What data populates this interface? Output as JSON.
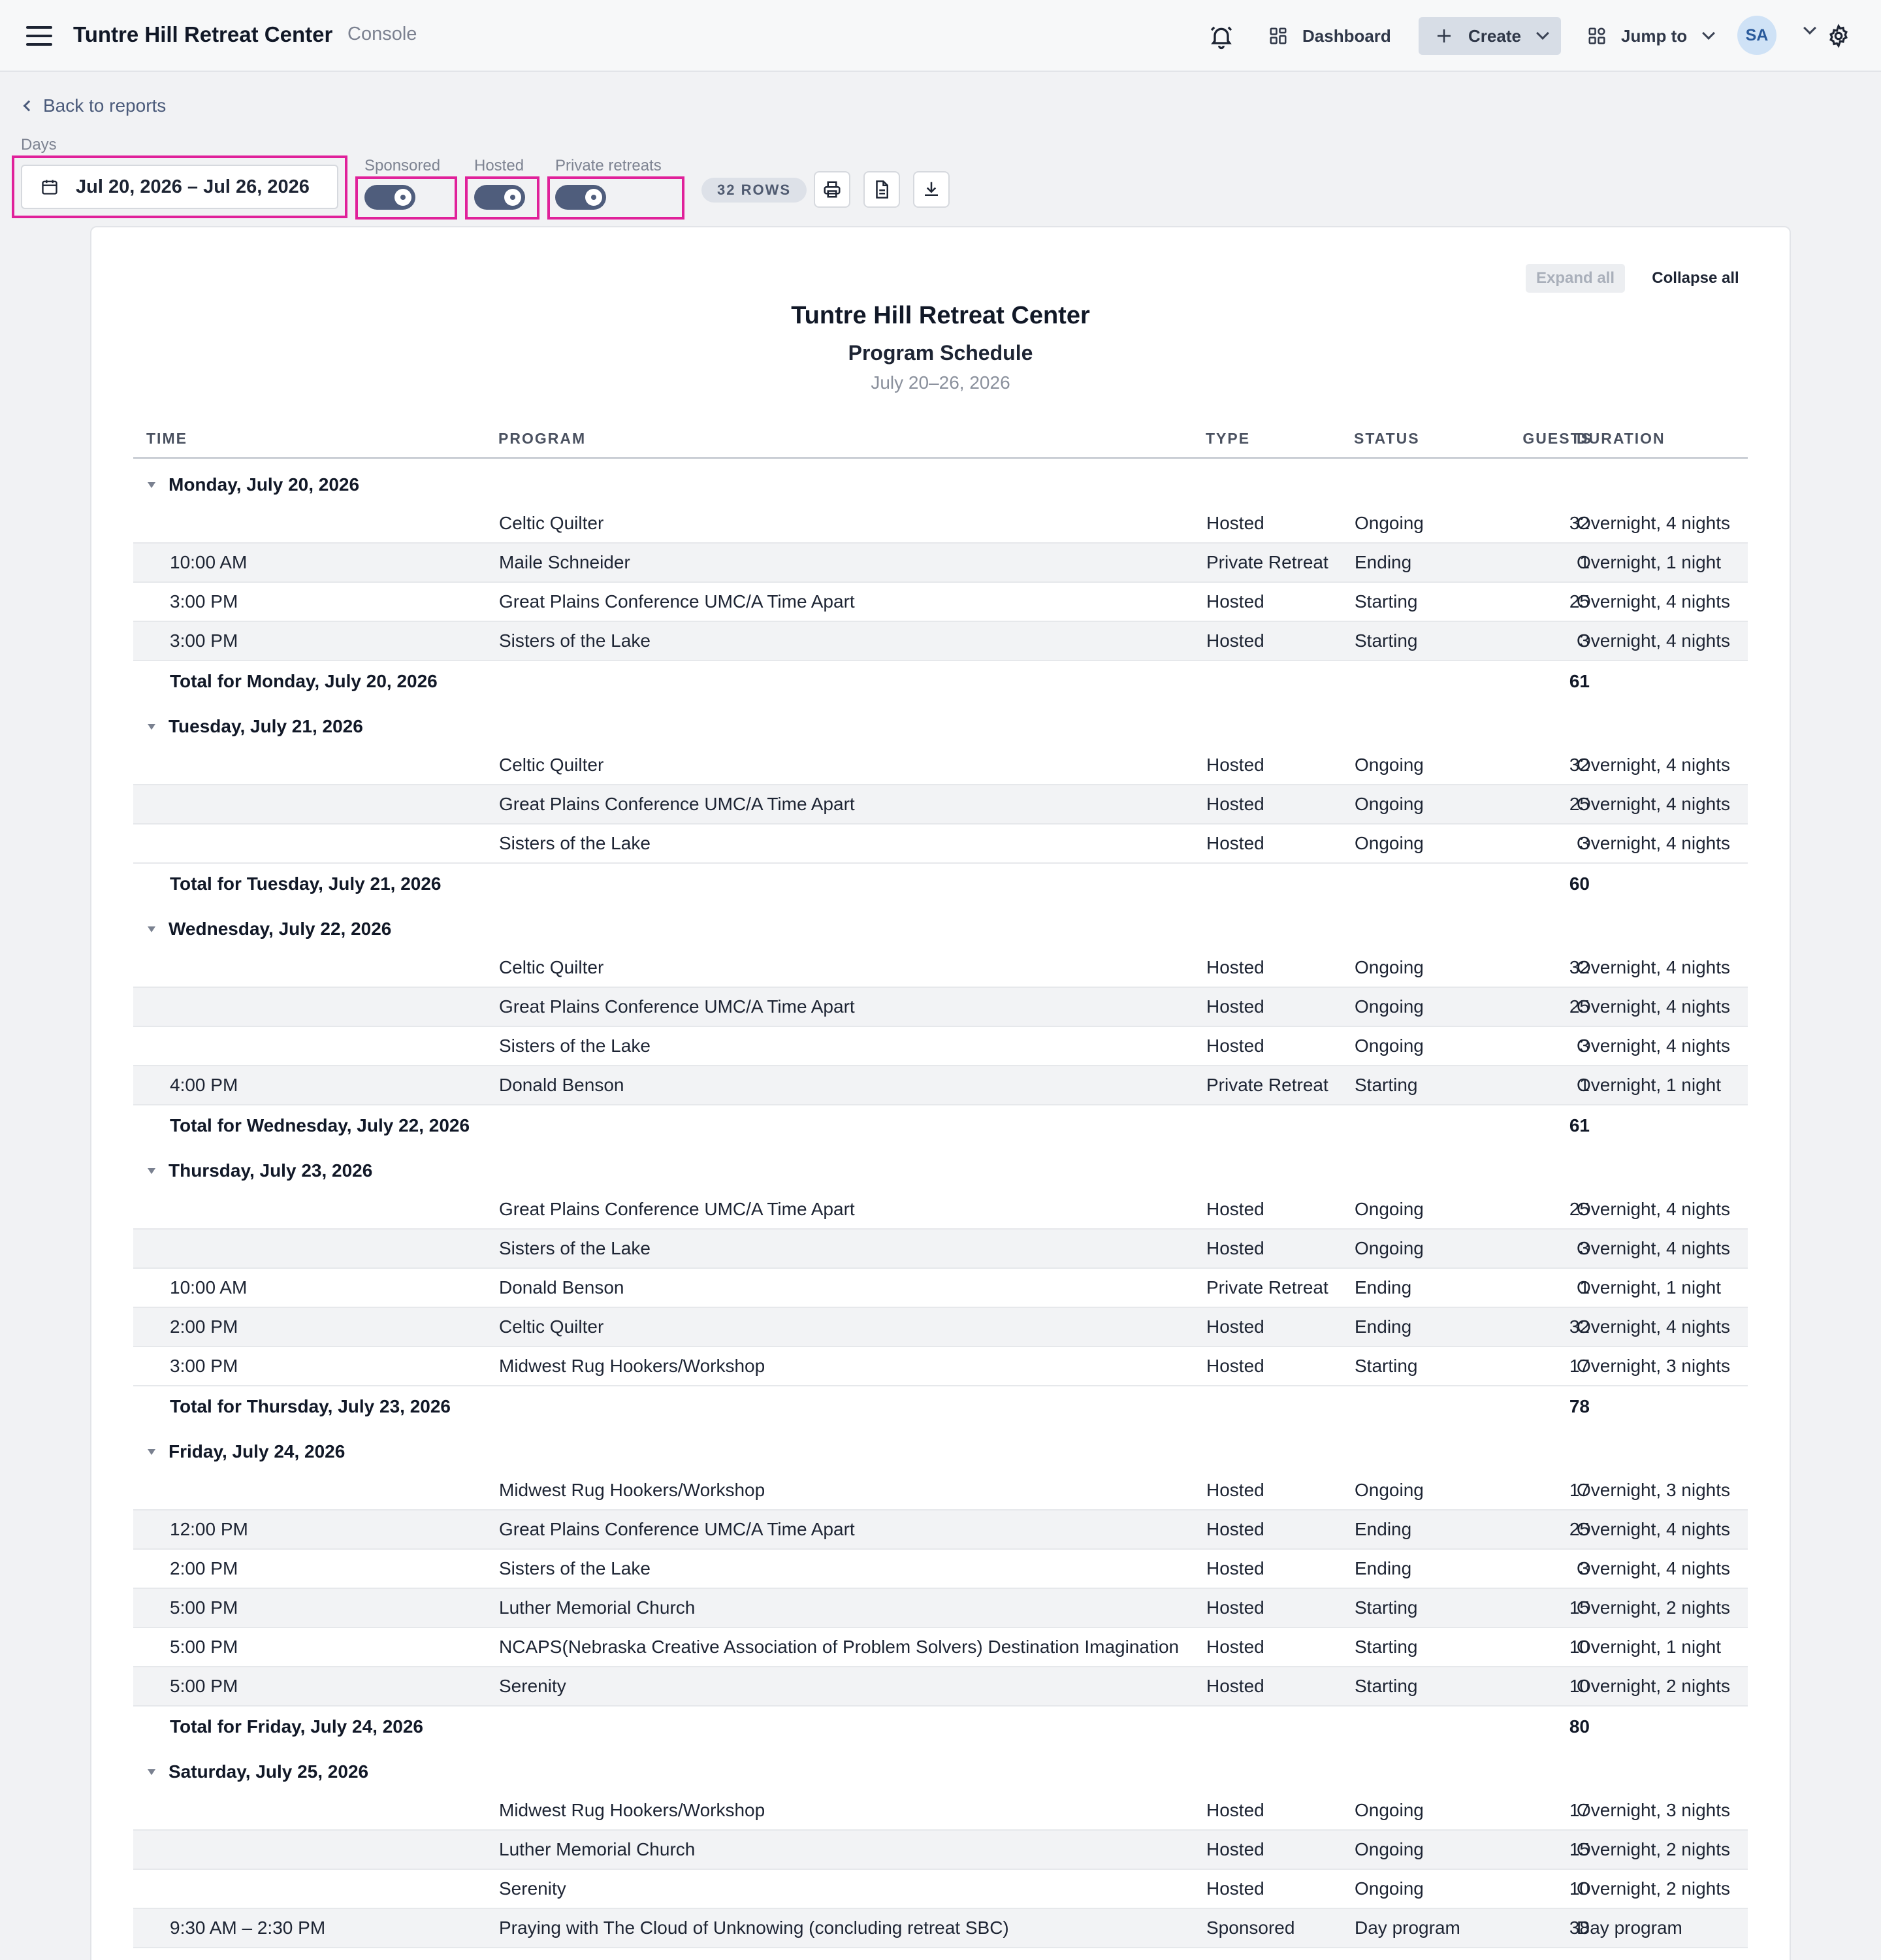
{
  "header": {
    "app_title": "Tuntre Hill Retreat Center",
    "app_subtitle": "Console",
    "dashboard_label": "Dashboard",
    "create_label": "Create",
    "jump_label": "Jump to",
    "avatar_initials": "SA"
  },
  "nav": {
    "back_label": "Back to reports"
  },
  "filters": {
    "days_label": "Days",
    "date_range": "Jul 20, 2026 – Jul 26, 2026",
    "sponsored_label": "Sponsored",
    "hosted_label": "Hosted",
    "private_label": "Private retreats",
    "toggles_on": true,
    "rows_badge": "32 ROWS"
  },
  "report": {
    "expand_label": "Expand all",
    "collapse_label": "Collapse all",
    "title": "Tuntre Hill Retreat Center",
    "subtitle": "Program Schedule",
    "dates": "July 20–26, 2026",
    "columns": {
      "time": "TIME",
      "program": "PROGRAM",
      "type": "TYPE",
      "status": "STATUS",
      "guests": "GUESTS",
      "duration": "DURATION"
    },
    "days": [
      {
        "heading": "Monday, July 20, 2026",
        "rows": [
          {
            "time": "",
            "program": "Celtic Quilter",
            "type": "Hosted",
            "status": "Ongoing",
            "guests": "32",
            "duration": "Overnight, 4 nights"
          },
          {
            "time": "10:00 AM",
            "program": "Maile Schneider",
            "type": "Private Retreat",
            "status": "Ending",
            "guests": "1",
            "duration": "Overnight, 1 night"
          },
          {
            "time": "3:00 PM",
            "program": "Great Plains Conference UMC/A Time Apart",
            "type": "Hosted",
            "status": "Starting",
            "guests": "25",
            "duration": "Overnight, 4 nights"
          },
          {
            "time": "3:00 PM",
            "program": "Sisters of the Lake",
            "type": "Hosted",
            "status": "Starting",
            "guests": "3",
            "duration": "Overnight, 4 nights"
          }
        ],
        "total_label": "Total for Monday, July 20, 2026",
        "total": "61"
      },
      {
        "heading": "Tuesday, July 21, 2026",
        "rows": [
          {
            "time": "",
            "program": "Celtic Quilter",
            "type": "Hosted",
            "status": "Ongoing",
            "guests": "32",
            "duration": "Overnight, 4 nights"
          },
          {
            "time": "",
            "program": "Great Plains Conference UMC/A Time Apart",
            "type": "Hosted",
            "status": "Ongoing",
            "guests": "25",
            "duration": "Overnight, 4 nights"
          },
          {
            "time": "",
            "program": "Sisters of the Lake",
            "type": "Hosted",
            "status": "Ongoing",
            "guests": "3",
            "duration": "Overnight, 4 nights"
          }
        ],
        "total_label": "Total for Tuesday, July 21, 2026",
        "total": "60"
      },
      {
        "heading": "Wednesday, July 22, 2026",
        "rows": [
          {
            "time": "",
            "program": "Celtic Quilter",
            "type": "Hosted",
            "status": "Ongoing",
            "guests": "32",
            "duration": "Overnight, 4 nights"
          },
          {
            "time": "",
            "program": "Great Plains Conference UMC/A Time Apart",
            "type": "Hosted",
            "status": "Ongoing",
            "guests": "25",
            "duration": "Overnight, 4 nights"
          },
          {
            "time": "",
            "program": "Sisters of the Lake",
            "type": "Hosted",
            "status": "Ongoing",
            "guests": "3",
            "duration": "Overnight, 4 nights"
          },
          {
            "time": "4:00 PM",
            "program": "Donald Benson",
            "type": "Private Retreat",
            "status": "Starting",
            "guests": "1",
            "duration": "Overnight, 1 night"
          }
        ],
        "total_label": "Total for Wednesday, July 22, 2026",
        "total": "61"
      },
      {
        "heading": "Thursday, July 23, 2026",
        "rows": [
          {
            "time": "",
            "program": "Great Plains Conference UMC/A Time Apart",
            "type": "Hosted",
            "status": "Ongoing",
            "guests": "25",
            "duration": "Overnight, 4 nights"
          },
          {
            "time": "",
            "program": "Sisters of the Lake",
            "type": "Hosted",
            "status": "Ongoing",
            "guests": "3",
            "duration": "Overnight, 4 nights"
          },
          {
            "time": "10:00 AM",
            "program": "Donald Benson",
            "type": "Private Retreat",
            "status": "Ending",
            "guests": "1",
            "duration": "Overnight, 1 night"
          },
          {
            "time": "2:00 PM",
            "program": "Celtic Quilter",
            "type": "Hosted",
            "status": "Ending",
            "guests": "32",
            "duration": "Overnight, 4 nights"
          },
          {
            "time": "3:00 PM",
            "program": "Midwest Rug Hookers/Workshop",
            "type": "Hosted",
            "status": "Starting",
            "guests": "17",
            "duration": "Overnight, 3 nights"
          }
        ],
        "total_label": "Total for Thursday, July 23, 2026",
        "total": "78"
      },
      {
        "heading": "Friday, July 24, 2026",
        "rows": [
          {
            "time": "",
            "program": "Midwest Rug Hookers/Workshop",
            "type": "Hosted",
            "status": "Ongoing",
            "guests": "17",
            "duration": "Overnight, 3 nights"
          },
          {
            "time": "12:00 PM",
            "program": "Great Plains Conference UMC/A Time Apart",
            "type": "Hosted",
            "status": "Ending",
            "guests": "25",
            "duration": "Overnight, 4 nights"
          },
          {
            "time": "2:00 PM",
            "program": "Sisters of the Lake",
            "type": "Hosted",
            "status": "Ending",
            "guests": "3",
            "duration": "Overnight, 4 nights"
          },
          {
            "time": "5:00 PM",
            "program": "Luther Memorial Church",
            "type": "Hosted",
            "status": "Starting",
            "guests": "15",
            "duration": "Overnight, 2 nights"
          },
          {
            "time": "5:00 PM",
            "program": "NCAPS(Nebraska Creative Association of Problem Solvers) Destination Imagination",
            "type": "Hosted",
            "status": "Starting",
            "guests": "10",
            "duration": "Overnight, 1 night"
          },
          {
            "time": "5:00 PM",
            "program": "Serenity",
            "type": "Hosted",
            "status": "Starting",
            "guests": "10",
            "duration": "Overnight, 2 nights"
          }
        ],
        "total_label": "Total for Friday, July 24, 2026",
        "total": "80"
      },
      {
        "heading": "Saturday, July 25, 2026",
        "rows": [
          {
            "time": "",
            "program": "Midwest Rug Hookers/Workshop",
            "type": "Hosted",
            "status": "Ongoing",
            "guests": "17",
            "duration": "Overnight, 3 nights"
          },
          {
            "time": "",
            "program": "Luther Memorial Church",
            "type": "Hosted",
            "status": "Ongoing",
            "guests": "15",
            "duration": "Overnight, 2 nights"
          },
          {
            "time": "",
            "program": "Serenity",
            "type": "Hosted",
            "status": "Ongoing",
            "guests": "10",
            "duration": "Overnight, 2 nights"
          },
          {
            "time": "9:30 AM – 2:30 PM",
            "program": "Praying with The Cloud of Unknowing (concluding retreat SBC)",
            "type": "Sponsored",
            "status": "Day program",
            "guests": "38",
            "duration": "Day program"
          }
        ],
        "total_label": "",
        "total": ""
      }
    ]
  }
}
